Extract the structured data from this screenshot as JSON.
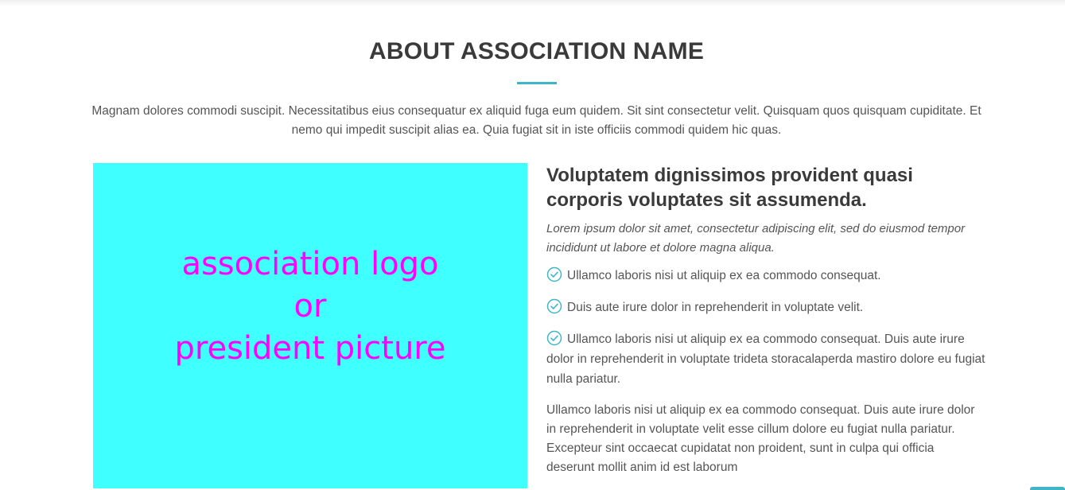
{
  "section": {
    "title": "ABOUT ASSOCIATION NAME",
    "intro": "Magnam dolores commodi suscipit. Necessitatibus eius consequatur ex aliquid fuga eum quidem. Sit sint consectetur velit. Quisquam quos quisquam cupiditate. Et nemo qui impedit suscipit alias ea. Quia fugiat sit in iste officiis commodi quidem hic quas.",
    "accent_color": "#3fb5c7"
  },
  "image_placeholder": {
    "text": "association logo\nor\npresident picture",
    "background_color": "#40ffff",
    "text_color": "#ff00ff"
  },
  "content": {
    "heading": "Voluptatem dignissimos provident quasi corporis voluptates sit assumenda.",
    "lead": "Lorem ipsum dolor sit amet, consectetur adipiscing elit, sed do eiusmod tempor incididunt ut labore et dolore magna aliqua.",
    "checklist": [
      {
        "icon": "check-circle-icon",
        "text": "Ullamco laboris nisi ut aliquip ex ea commodo consequat."
      },
      {
        "icon": "check-circle-icon",
        "text": "Duis aute irure dolor in reprehenderit in voluptate velit."
      },
      {
        "icon": "check-circle-icon",
        "text": "Ullamco laboris nisi ut aliquip ex ea commodo consequat. Duis aute irure dolor in reprehenderit in voluptate trideta storacalaperda mastiro dolore eu fugiat nulla pariatur."
      }
    ],
    "paragraph": "Ullamco laboris nisi ut aliquip ex ea commodo consequat. Duis aute irure dolor in reprehenderit in voluptate velit esse cillum dolore eu fugiat nulla pariatur. Excepteur sint occaecat cupidatat non proident, sunt in culpa qui officia deserunt mollit anim id est laborum"
  }
}
